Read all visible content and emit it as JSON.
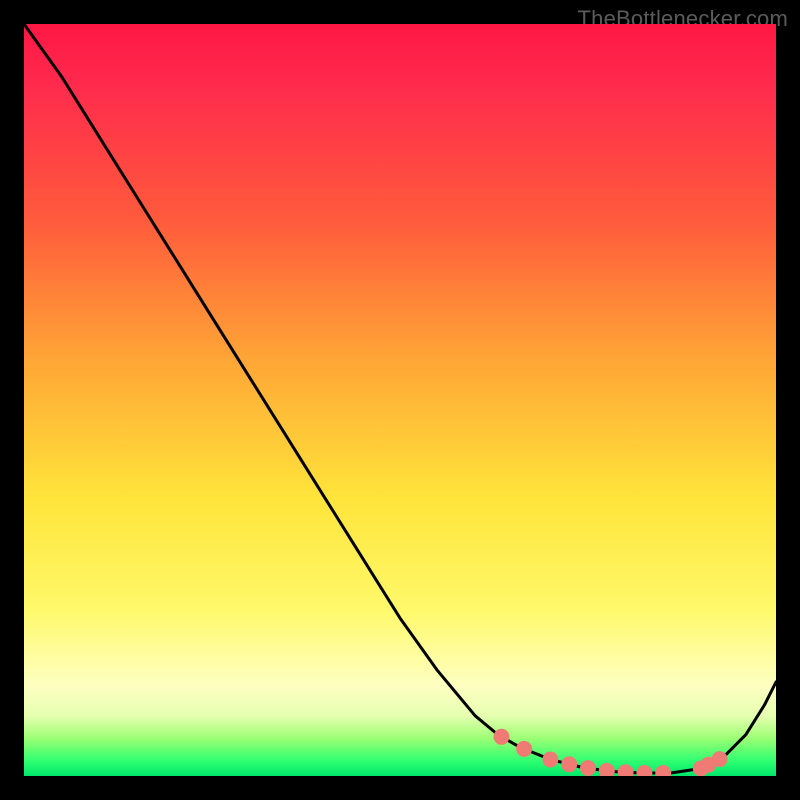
{
  "watermark": {
    "text": "TheBottlenecker.com"
  },
  "chart_data": {
    "type": "line",
    "title": "",
    "xlabel": "",
    "ylabel": "",
    "xlim": [
      0,
      1
    ],
    "ylim": [
      0,
      1
    ],
    "grid": false,
    "background_gradient": {
      "orientation": "vertical",
      "stops": [
        {
          "pos": 0.0,
          "color": "#ff1744"
        },
        {
          "pos": 0.45,
          "color": "#ffa736"
        },
        {
          "pos": 0.78,
          "color": "#fff96b"
        },
        {
          "pos": 0.95,
          "color": "#9cff74"
        },
        {
          "pos": 1.0,
          "color": "#00e66b"
        }
      ]
    },
    "series": [
      {
        "name": "curve",
        "stroke": "#000000",
        "stroke_width": 3,
        "x": [
          0.0,
          0.05,
          0.1,
          0.15,
          0.2,
          0.25,
          0.3,
          0.35,
          0.4,
          0.45,
          0.5,
          0.55,
          0.6,
          0.63,
          0.66,
          0.7,
          0.74,
          0.78,
          0.82,
          0.86,
          0.9,
          0.93,
          0.96,
          0.985,
          1.0
        ],
        "y": [
          1.0,
          0.93,
          0.85,
          0.77,
          0.69,
          0.61,
          0.53,
          0.45,
          0.37,
          0.29,
          0.21,
          0.14,
          0.08,
          0.055,
          0.038,
          0.022,
          0.012,
          0.006,
          0.004,
          0.004,
          0.01,
          0.025,
          0.055,
          0.095,
          0.125
        ]
      }
    ],
    "markers": {
      "series": "curve",
      "color": "#f07a74",
      "radius": 8,
      "indices_x": [
        0.635,
        0.665,
        0.7,
        0.725,
        0.75,
        0.775,
        0.8,
        0.825,
        0.85,
        0.9,
        0.91,
        0.925
      ]
    }
  }
}
